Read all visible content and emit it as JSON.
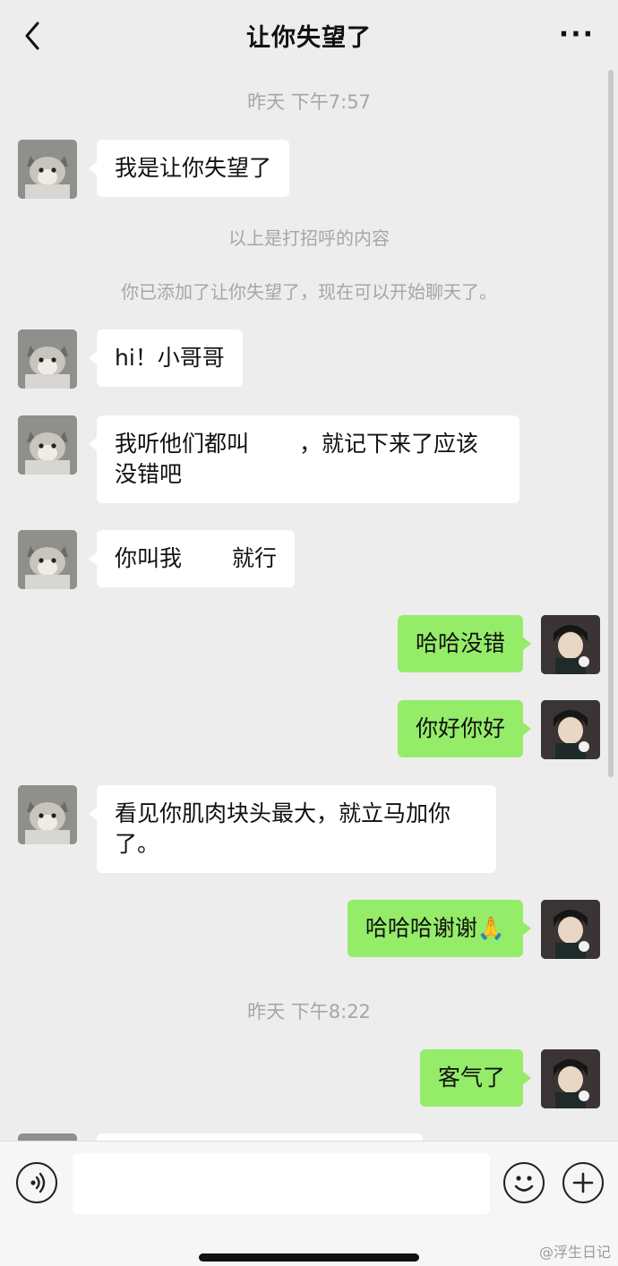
{
  "header": {
    "title": "让你失望了",
    "back_icon": "chevron-left-icon",
    "more_icon": "more-dots-icon",
    "more_label": "···"
  },
  "timestamps": [
    "昨天 下午7:57",
    "昨天 下午8:22"
  ],
  "system": {
    "greeting_note": "以上是打招呼的内容",
    "added_note": "你已添加了让你失望了，现在可以开始聊天了。"
  },
  "messages": [
    {
      "from": "them",
      "text": "我是让你失望了"
    },
    {
      "from": "them",
      "text": "hi！小哥哥"
    },
    {
      "from": "them",
      "text_a": "我听他们都叫",
      "text_b": "，就记下来了应该",
      "text_c": "没错吧"
    },
    {
      "from": "them",
      "text_a": "你叫我",
      "text_b": "就行"
    },
    {
      "from": "me",
      "text": "哈哈没错"
    },
    {
      "from": "me",
      "text": "你好你好"
    },
    {
      "from": "them",
      "text_a": "看见你肌肉块头最大，就立马加你",
      "text_b": "了。"
    },
    {
      "from": "me",
      "text": "哈哈哈谢谢",
      "emoji": "🙏"
    },
    {
      "from": "me",
      "text": "客气了"
    }
  ],
  "input": {
    "placeholder": ""
  },
  "icons": {
    "voice": "voice-icon",
    "emoji": "emoji-icon",
    "plus": "plus-icon"
  },
  "watermark": "@浮生日记",
  "colors": {
    "background": "#ededed",
    "incoming_bubble": "#ffffff",
    "outgoing_bubble": "#95ec69"
  }
}
